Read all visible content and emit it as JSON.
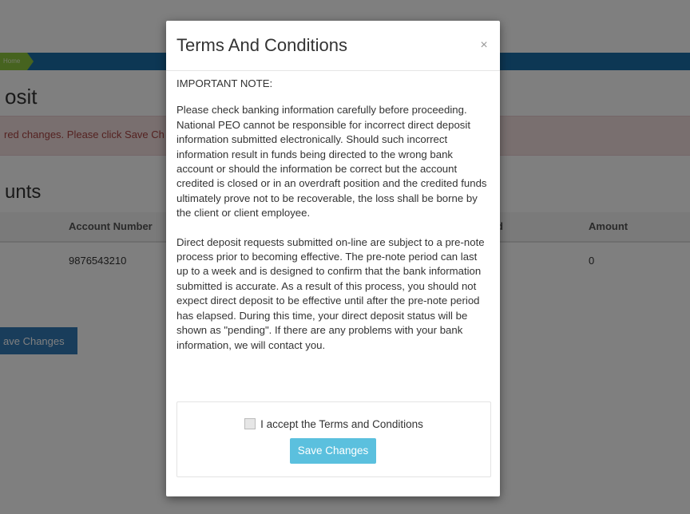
{
  "background": {
    "breadcrumb_label": "Home",
    "page_title": "osit",
    "alert_text": "red changes. Please click Save Ch",
    "section_title": "unts",
    "table": {
      "headers": [
        "Account Number",
        "d",
        "Amount"
      ],
      "rows": [
        {
          "account_number": "9876543210",
          "amount": "0"
        }
      ]
    },
    "save_button_label": "ave Changes"
  },
  "modal": {
    "title": "Terms And Conditions",
    "close_label": "×",
    "important_note": "IMPORTANT NOTE:",
    "paragraph_1": "Please check banking information carefully before proceeding. National PEO cannot be responsible for incorrect direct deposit information submitted electronically. Should such incorrect information result in funds being directed to the wrong bank account or should the information be correct but the account credited is closed or in an overdraft position and the credited funds ultimately prove not to be recoverable, the loss shall be borne by the client or client employee.",
    "paragraph_2": "Direct deposit requests submitted on-line are subject to a pre-note process prior to becoming effective. The pre-note period can last up to a week and is designed to confirm that the bank information submitted is accurate. As a result of this process, you should not expect direct deposit to be effective until after the pre-note period has elapsed. During this time, your direct deposit status will be shown as \"pending\". If there are any problems with your bank information, we will contact you.",
    "accept_label": "I accept the Terms and Conditions",
    "accept_checked": false,
    "save_button_label": "Save Changes"
  },
  "colors": {
    "nav": "#1b6fa8",
    "breadcrumb": "#8cc63f",
    "alert_bg": "#f2dede",
    "alert_text": "#a94442",
    "primary_button": "#337ab7",
    "info_button": "#5bc0de"
  }
}
